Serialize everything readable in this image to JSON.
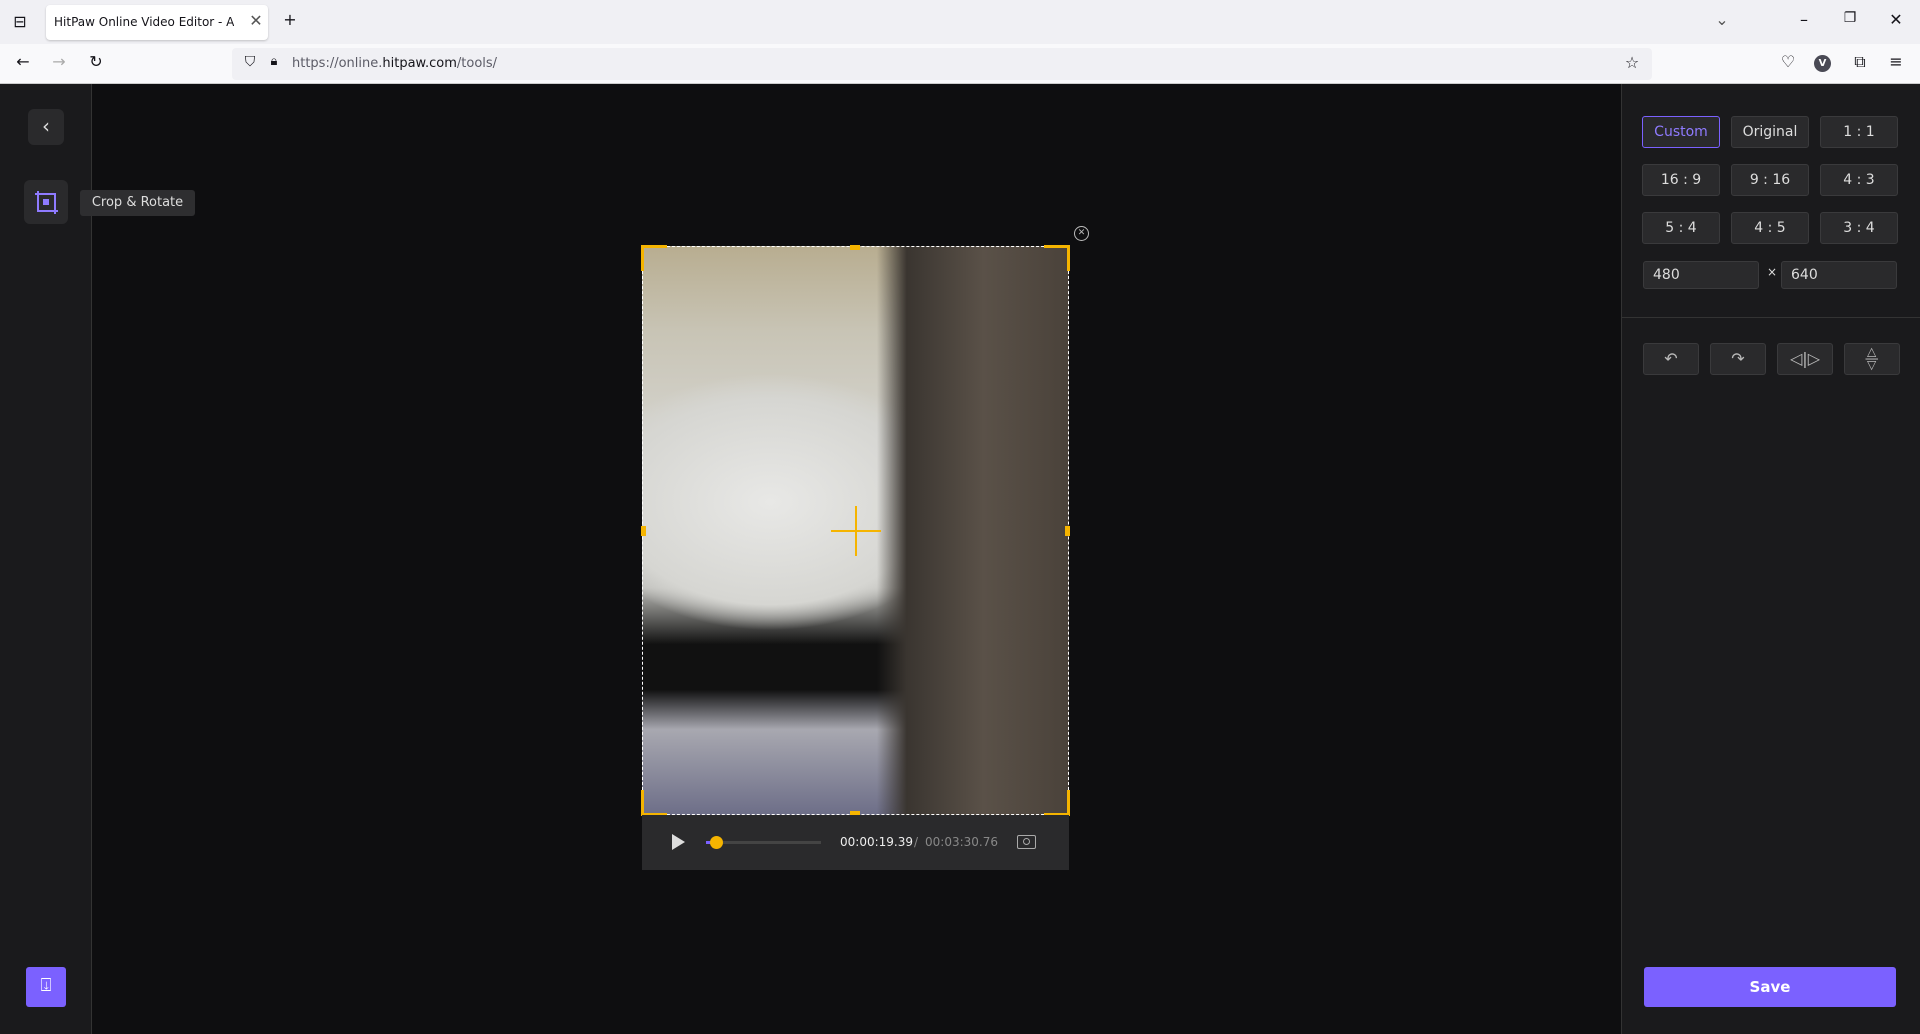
{
  "browser": {
    "tab_title": "HitPaw Online Video Editor - All-in-one",
    "url_prefix": "https://online.",
    "url_domain": "hitpaw.com",
    "url_path": "/tools/",
    "profile_initial": "V"
  },
  "sidebar": {
    "tool_tooltip": "Crop & Rotate"
  },
  "player": {
    "current_time": "00:00:19.39",
    "separator": "/",
    "total_time": "00:03:30.76",
    "progress": 0.09
  },
  "panel": {
    "ratios": [
      "Custom",
      "Original",
      "1 : 1",
      "16 : 9",
      "9 : 16",
      "4 : 3",
      "5 : 4",
      "4 : 5",
      "3 : 4"
    ],
    "selected_ratio": "Custom",
    "width": "480",
    "height": "640",
    "times": "×",
    "save_label": "Save"
  },
  "colors": {
    "accent": "#7b61ff",
    "crop_handle": "#f5b400"
  }
}
